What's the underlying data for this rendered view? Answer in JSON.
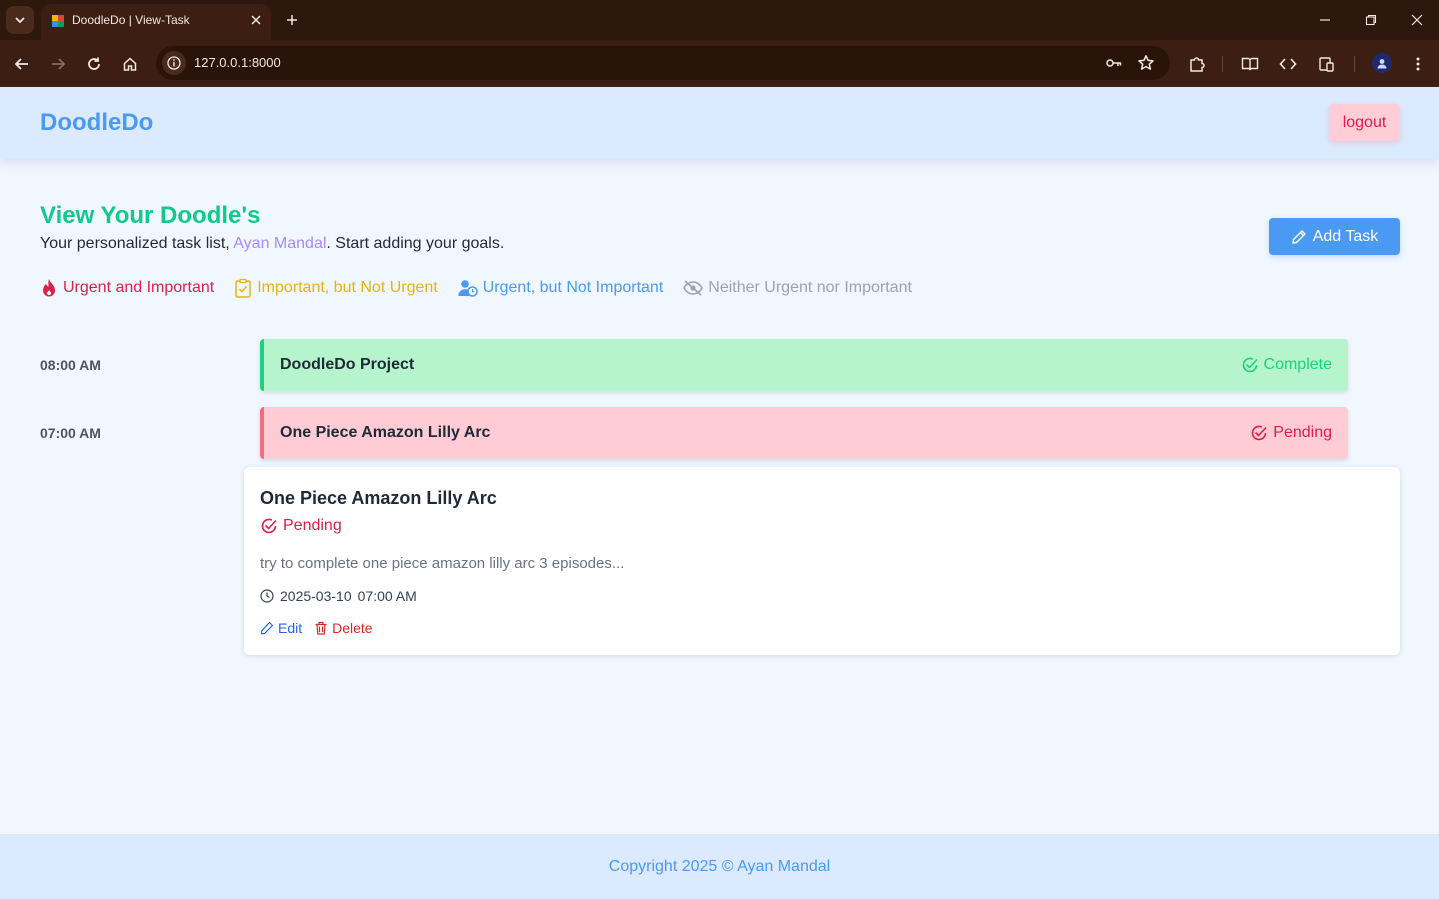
{
  "browser": {
    "tab_title": "DoodleDo | View-Task",
    "url": "127.0.0.1:8000"
  },
  "header": {
    "brand": "DoodleDo",
    "logout_label": "logout"
  },
  "intro": {
    "title": "View Your Doodle's",
    "subtitle_prefix": "Your personalized task list, ",
    "user_name": "Ayan Mandal",
    "subtitle_suffix": ". Start adding your goals.",
    "add_task_label": "Add Task"
  },
  "legend": [
    {
      "label": "Urgent and Important",
      "icon": "fire-icon",
      "color": "#e11d48"
    },
    {
      "label": "Important, but Not Urgent",
      "icon": "clipboard-check-icon",
      "color": "#eab308"
    },
    {
      "label": "Urgent, but Not Important",
      "icon": "user-clock-icon",
      "color": "#4a9af4"
    },
    {
      "label": "Neither Urgent nor Important",
      "icon": "eye-slash-icon",
      "color": "#9ca3af"
    }
  ],
  "tasks": [
    {
      "time": "08:00 AM",
      "title": "DoodleDo Project",
      "status": "Complete",
      "status_color": "#1ad27e"
    },
    {
      "time": "07:00 AM",
      "title": "One Piece Amazon Lilly Arc",
      "status": "Pending",
      "status_color": "#e11d48"
    }
  ],
  "detail": {
    "title": "One Piece Amazon Lilly Arc",
    "status": "Pending",
    "description": "try to complete one piece amazon lilly arc 3 episodes...",
    "date": "2025-03-10",
    "time": "07:00 AM",
    "edit_label": "Edit",
    "delete_label": "Delete"
  },
  "footer": {
    "text": "Copyright 2025 © Ayan Mandal"
  },
  "colors": {
    "brand": "#4a9af4",
    "title_green": "#10c98a",
    "danger": "#e11d48",
    "complete": "#1ad27e"
  }
}
